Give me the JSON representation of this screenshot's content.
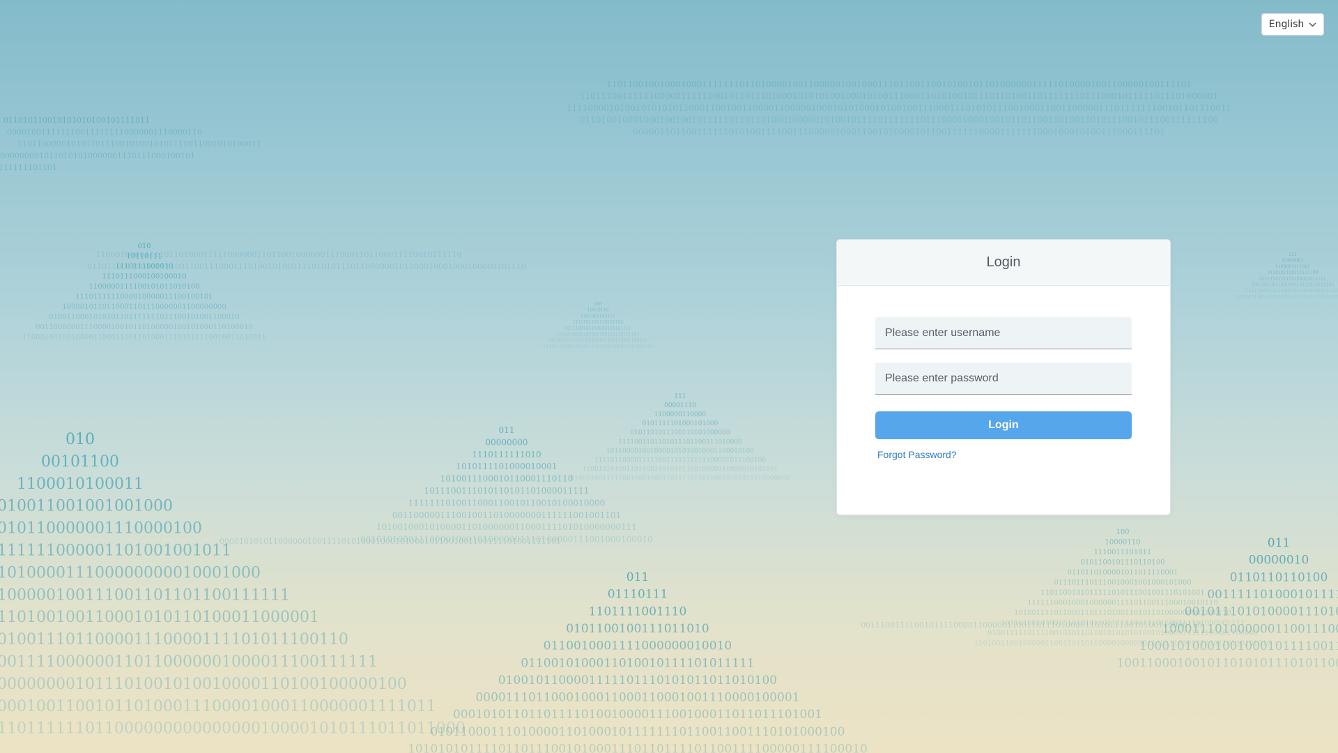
{
  "language_selector": {
    "value": "English",
    "icon": "chevron-down-icon"
  },
  "login_card": {
    "title": "Login",
    "username_placeholder": "Please enter username",
    "password_placeholder": "Please enter password",
    "login_button": "Login",
    "forgot_password": "Forgot Password?"
  },
  "colors": {
    "accent": "#56a6eb",
    "link": "#2d7cc2",
    "background_top": "#83bbca",
    "background_bottom": "#ece3c4",
    "binary_digits": "#3e9db2"
  }
}
